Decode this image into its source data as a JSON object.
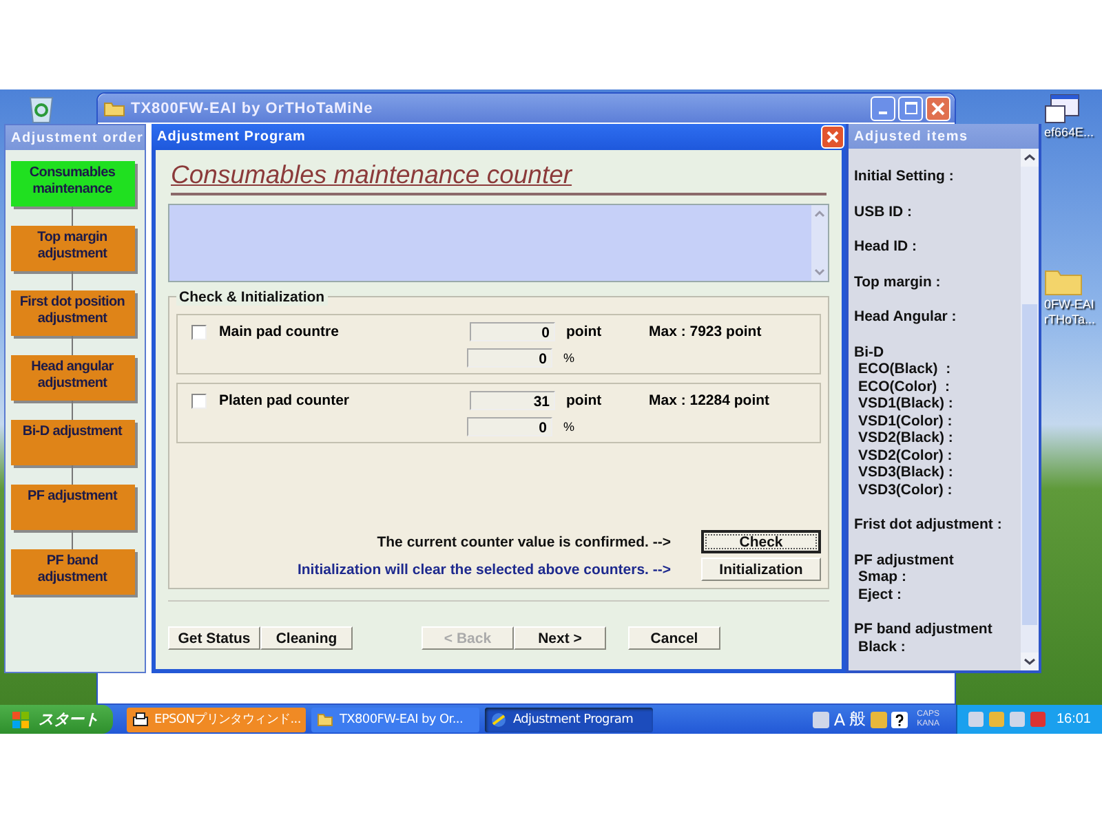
{
  "desktop_icons": [
    {
      "kind": "window",
      "lines": [
        "ef664E..."
      ]
    },
    {
      "kind": "folder",
      "lines": [
        "0FW-EAI",
        "rTHoTa..."
      ]
    }
  ],
  "background_window": {
    "title": "TX800FW-EAI by OrTHoTaMiNe"
  },
  "adjustment_order": {
    "title": "Adjustment order",
    "steps": [
      {
        "label": "Consumables maintenance",
        "selected": true
      },
      {
        "label": "Top margin adjustment",
        "selected": false
      },
      {
        "label": "First dot position adjustment",
        "selected": false
      },
      {
        "label": "Head angular adjustment",
        "selected": false
      },
      {
        "label": "Bi-D adjustment",
        "selected": false
      },
      {
        "label": "PF adjustment",
        "selected": false
      },
      {
        "label": "PF band adjustment",
        "selected": false
      }
    ]
  },
  "dialog": {
    "title": "Adjustment Program",
    "heading": "Consumables maintenance counter",
    "group_title": "Check & Initialization",
    "counters": [
      {
        "label": "Main pad countre",
        "checked": false,
        "value": "0",
        "unit": "point",
        "max": "Max : 7923 point",
        "percent": "0",
        "percent_unit": "%"
      },
      {
        "label": "Platen pad counter",
        "checked": false,
        "value": "31",
        "unit": "point",
        "max": "Max : 12284 point",
        "percent": "0",
        "percent_unit": "%"
      }
    ],
    "check_note": "The current counter value is confirmed. -->",
    "check_button": "Check",
    "init_note": "Initialization will clear the selected above counters. -->",
    "init_button": "Initialization",
    "left_buttons": [
      {
        "label": "Get Status",
        "disabled": false
      },
      {
        "label": "Cleaning",
        "disabled": false
      }
    ],
    "nav_buttons": [
      {
        "label": "< Back",
        "disabled": true
      },
      {
        "label": "Next >",
        "disabled": false
      },
      {
        "label": "Cancel",
        "disabled": false
      }
    ]
  },
  "adjusted_items": {
    "title": "Adjusted items",
    "sections": [
      {
        "label": "Initial Setting :"
      },
      {
        "label": "USB ID :"
      },
      {
        "label": "Head ID :"
      },
      {
        "label": "Top margin :"
      },
      {
        "label": "Head Angular :"
      },
      {
        "label": "Bi-D",
        "children": [
          {
            "label": "ECO(Black)  :"
          },
          {
            "label": "ECO(Color)  :"
          },
          {
            "label": "VSD1(Black) :"
          },
          {
            "label": "VSD1(Color) :"
          },
          {
            "label": "VSD2(Black) :"
          },
          {
            "label": "VSD2(Color) :"
          },
          {
            "label": "VSD3(Black) :"
          },
          {
            "label": "VSD3(Color) :"
          }
        ]
      },
      {
        "label": "Frist dot adjustment :"
      },
      {
        "label": "PF adjustment",
        "children": [
          {
            "label": "Smap :"
          },
          {
            "label": "Eject :"
          }
        ]
      },
      {
        "label": "PF band adjustment",
        "children": [
          {
            "label": "Black :"
          }
        ]
      }
    ]
  },
  "taskbar": {
    "start": "スタート",
    "tasks": [
      {
        "kind": "printer",
        "label": "EPSONプリンタウィンド...",
        "flashing": true,
        "selected": false
      },
      {
        "kind": "folder",
        "label": "TX800FW-EAI by Or...",
        "flashing": false,
        "selected": false
      },
      {
        "kind": "program",
        "label": "Adjustment Program",
        "flashing": false,
        "selected": true
      }
    ],
    "ime_mode": "A",
    "ime_input": "般",
    "caps": "CAPS",
    "kana": "KANA",
    "clock": "16:01"
  }
}
